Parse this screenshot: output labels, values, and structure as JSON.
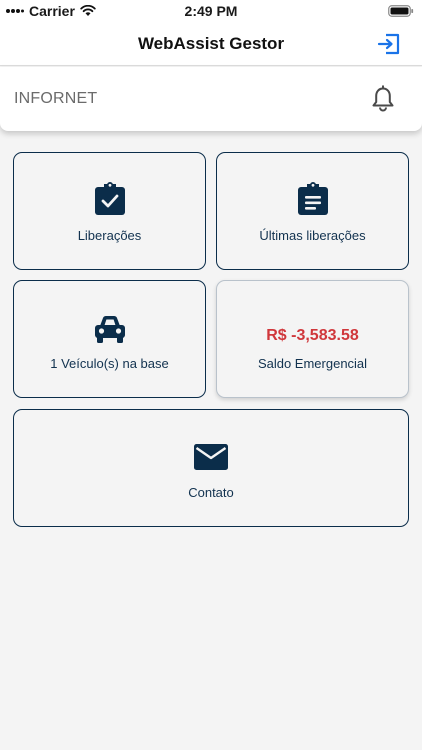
{
  "status_bar": {
    "carrier": "Carrier",
    "time": "2:49 PM",
    "icons": [
      "wifi-icon",
      "battery-icon"
    ]
  },
  "nav": {
    "title": "WebAssist Gestor",
    "action_icon": "logout-icon",
    "accent_color": "#1a73e8"
  },
  "header": {
    "company": "INFORNET",
    "action_icon": "bell-icon"
  },
  "tiles": [
    {
      "label": "Liberações",
      "icon": "clipboard-check-icon"
    },
    {
      "label": "Últimas liberações",
      "icon": "clipboard-list-icon"
    },
    {
      "label": "1 Veículo(s) na base",
      "icon": "car-icon"
    },
    {
      "label": "Saldo Emergencial",
      "value": "R$ -3,583.58",
      "value_color": "#d0373b"
    },
    {
      "label": "Contato",
      "icon": "envelope-icon"
    }
  ],
  "colors": {
    "primary_dark": "#0b2d4a",
    "background": "#f4f4f4"
  }
}
